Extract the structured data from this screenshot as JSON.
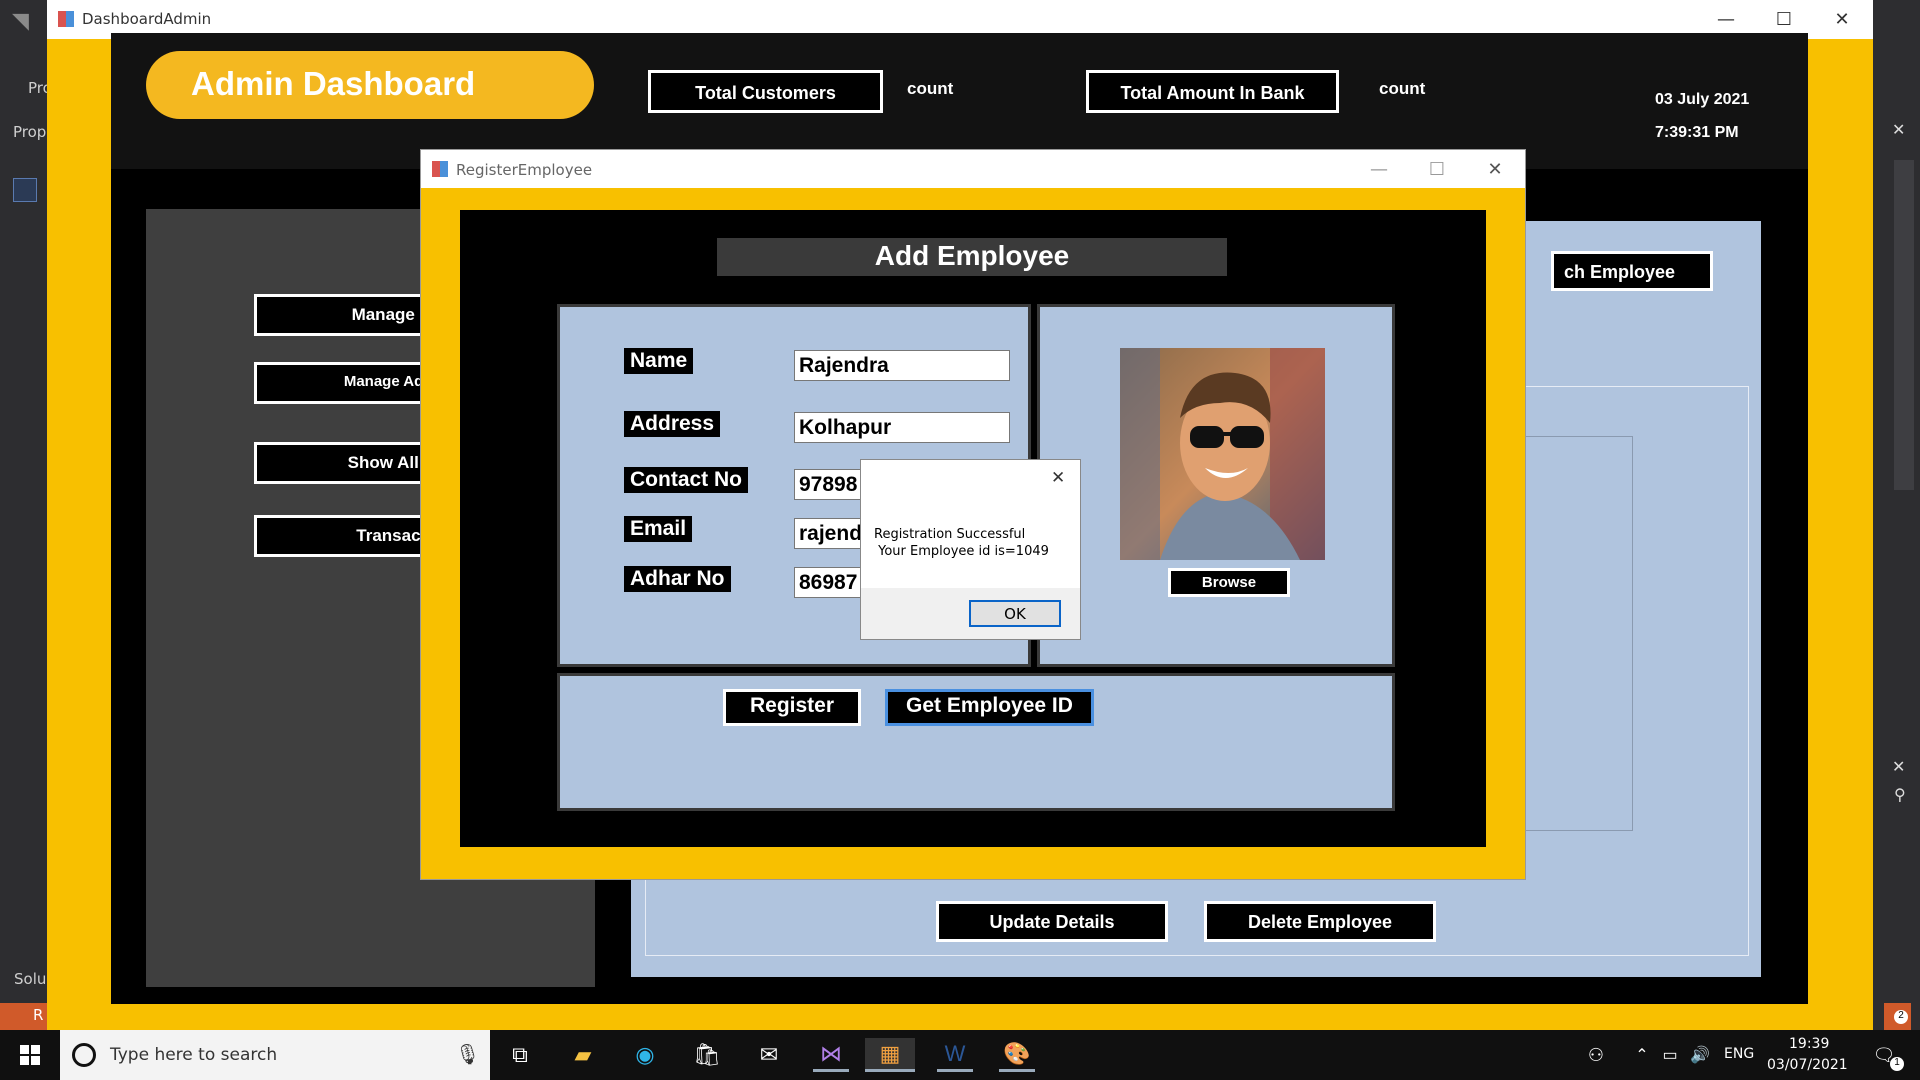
{
  "vs": {
    "left_texts": [
      "Pro",
      "Prop",
      "Solu",
      "R"
    ],
    "accent": "#d05a2a"
  },
  "dashboard": {
    "window_title": "DashboardAdmin",
    "heading": "Admin Dashboard",
    "total_customers_label": "Total Customers",
    "total_customers_value": "count",
    "total_amount_label": "Total Amount In Bank",
    "total_amount_value": "count",
    "date": "03 July 2021",
    "time": "7:39:31 PM",
    "menu": [
      "Manage Emp",
      "Manage Admin E",
      "Show All Emp",
      "Transaction"
    ],
    "search_employee_label": "ch Employee",
    "update_label": "Update Details",
    "delete_label": "Delete Employee",
    "colors": {
      "frame": "#f8c000",
      "panel": "#b0c4de",
      "dark": "#000000"
    }
  },
  "register": {
    "window_title": "RegisterEmployee",
    "heading": "Add Employee",
    "fields": [
      {
        "label": "Name",
        "value": "Rajendra"
      },
      {
        "label": "Address",
        "value": "Kolhapur"
      },
      {
        "label": "Contact No",
        "value": "97898"
      },
      {
        "label": "Email",
        "value": "rajend"
      },
      {
        "label": "Adhar No",
        "value": "86987"
      }
    ],
    "browse_label": "Browse",
    "register_label": "Register",
    "get_id_label": "Get Employee ID"
  },
  "message_box": {
    "line1": "Registration Successful",
    "line2": " Your Employee id is=1049",
    "ok_label": "OK"
  },
  "taskbar": {
    "search_placeholder": "Type here to search",
    "language": "ENG",
    "time": "19:39",
    "date": "03/07/2021",
    "notification_count": "1",
    "vs_notification_count": "2"
  }
}
